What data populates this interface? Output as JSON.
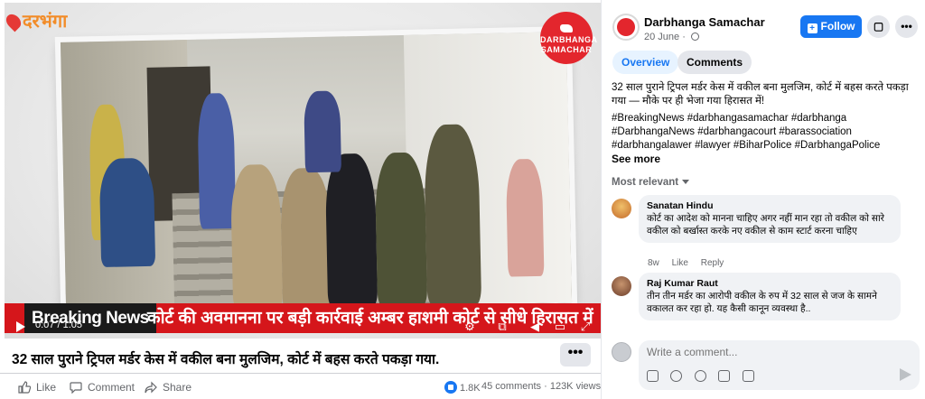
{
  "video": {
    "watermark_text": "दरभंगा",
    "brand_circle_text": "DARBHANGA SAMACHAR",
    "breaking_label": "Breaking News",
    "ticker_text": "कोर्ट की अवमानना पर बड़ी कार्रवाई अम्बर हाशमी कोर्ट से सीधे हिरासत में",
    "time": "0:07 / 1:05",
    "title": "32 साल पुराने ट्रिपल मर्डर केस में वकील बना मुलजिम, कोर्ट में बहस करते पकड़ा गया.",
    "more_label": "•••"
  },
  "actions": {
    "like": "Like",
    "comment": "Comment",
    "share": "Share",
    "reaction_count": "1.8K",
    "comments_count": "45 comments",
    "views": "123K views"
  },
  "page": {
    "name": "Darbhanga Samachar",
    "date": "20 June",
    "follow_label": "Follow"
  },
  "tabs": [
    {
      "label": "Overview",
      "active": true
    },
    {
      "label": "Comments",
      "active": false
    }
  ],
  "post": {
    "caption": "32 साल पुराने ट्रिपल मर्डर केस में वकील बना मुलजिम, कोर्ट में बहस करते पकड़ा गया — मौके पर ही भेजा गया हिरासत में!",
    "hashtags": "#BreakingNews #darbhangasamachar #darbhanga #DarbhangaNews #darbhangacourt #barassociation #darbhangalawer #lawyer #BiharPolice #DarbhangaPolice",
    "see_more": "See more"
  },
  "comments_section": {
    "sort_label": "Most relevant",
    "comments": [
      {
        "name": "Sanatan Hindu",
        "text": "कोर्ट का आदेश को मानना चाहिए अगर नहीं मान रहा तो वकील को सारे वकील को बर्खास्त करके नए वकील से काम स्टार्ट करना चाहिए",
        "time": "8w",
        "like": "Like",
        "reply": "Reply"
      },
      {
        "name": "Raj Kumar Raut",
        "text": "तीन तीन मर्डर का आरोपी वकील के रुप में 32 साल से जज के सामने वकालत कर रहा हो. यह कैसी कानून व्यवस्था है..",
        "time": "",
        "like": "",
        "reply": ""
      }
    ]
  },
  "compose": {
    "placeholder": "Write a comment..."
  },
  "colors": {
    "facebook_blue": "#1877f2",
    "breaking_red": "#d5161b",
    "bubble_gray": "#f0f2f5"
  }
}
